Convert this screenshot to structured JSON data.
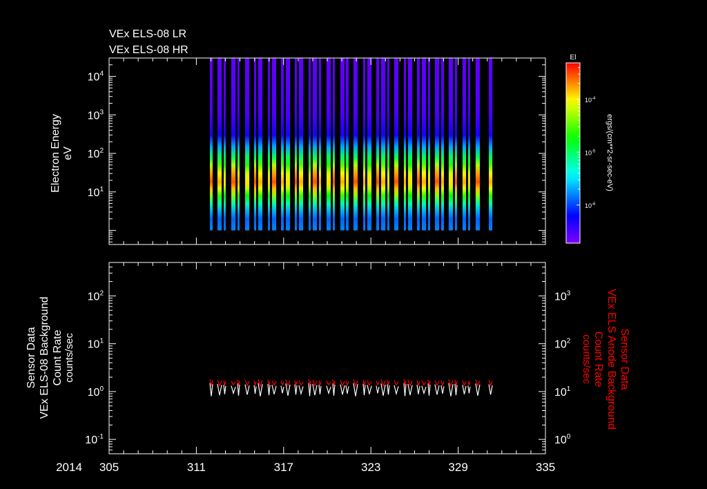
{
  "chart_data": [
    {
      "type": "heatmap",
      "titles": [
        "VEx ELS-08 LR",
        "VEx ELS-08 HR"
      ],
      "ylabel": [
        "Electron Energy",
        "eV"
      ],
      "yscale": "log",
      "ylim": [
        0.43,
        30000
      ],
      "yticks": [
        {
          "base": "10",
          "exp": "1",
          "value": 10
        },
        {
          "base": "10",
          "exp": "2",
          "value": 100
        },
        {
          "base": "10",
          "exp": "3",
          "value": 1000
        },
        {
          "base": "10",
          "exp": "4",
          "value": 10000
        }
      ],
      "energy_range_ev": [
        1,
        30000
      ],
      "colorbar": {
        "label": "El",
        "units": "ergs/(cm**2-sr-sec-eV)",
        "log_range": [
          -6.72,
          -3.31
        ],
        "ticks": [
          {
            "base": "10",
            "exp": "-4",
            "value": -4
          },
          {
            "base": "10",
            "exp": "-5",
            "value": -5
          },
          {
            "base": "10",
            "exp": "-6",
            "value": -6
          }
        ],
        "colors": [
          "#8000ff",
          "#0000ff",
          "#00ffff",
          "#00ff00",
          "#ffff00",
          "#ff0000"
        ]
      },
      "typical_spectrum": {
        "energy_ev": [
          1,
          2,
          3,
          5,
          8,
          12,
          18,
          30,
          50,
          80,
          150,
          300,
          1000,
          30000
        ],
        "log_flux": [
          -5.8,
          -5.9,
          -5.7,
          -5.2,
          -4.6,
          -4.1,
          -3.8,
          -4.0,
          -4.5,
          -5.0,
          -5.7,
          -6.3,
          -6.5,
          -6.6
        ]
      },
      "strips_day": [
        [
          311.93,
          312.12
        ],
        [
          312.45,
          312.74
        ],
        [
          312.88,
          313.02
        ],
        [
          313.4,
          313.69
        ],
        [
          313.83,
          313.97
        ],
        [
          314.35,
          314.64
        ],
        [
          314.97,
          315.11
        ],
        [
          315.25,
          315.54
        ],
        [
          315.92,
          316.06
        ],
        [
          316.2,
          316.49
        ],
        [
          316.82,
          317.01
        ],
        [
          317.15,
          317.44
        ],
        [
          317.77,
          317.91
        ],
        [
          318.05,
          318.34
        ],
        [
          318.72,
          318.86
        ],
        [
          319.0,
          319.29
        ],
        [
          319.43,
          319.57
        ],
        [
          319.95,
          320.24
        ],
        [
          320.38,
          320.52
        ],
        [
          320.9,
          321.19
        ],
        [
          321.28,
          321.47
        ],
        [
          321.8,
          322.09
        ],
        [
          322.47,
          322.61
        ],
        [
          322.75,
          323.04
        ],
        [
          323.37,
          323.56
        ],
        [
          323.7,
          323.99
        ],
        [
          324.13,
          324.27
        ],
        [
          324.6,
          324.89
        ],
        [
          325.27,
          325.41
        ],
        [
          325.55,
          325.84
        ],
        [
          326.17,
          326.36
        ],
        [
          326.5,
          326.79
        ],
        [
          326.93,
          327.07
        ],
        [
          327.4,
          327.69
        ],
        [
          327.83,
          328.02
        ],
        [
          328.35,
          328.64
        ],
        [
          328.78,
          328.92
        ],
        [
          329.3,
          329.54
        ],
        [
          329.68,
          329.82
        ],
        [
          330.2,
          330.49
        ],
        [
          331.11,
          331.35
        ]
      ]
    },
    {
      "type": "line",
      "ylabel_left": [
        "Sensor Data",
        "VEx ELS-08 Background",
        "Count Rate",
        "counts/sec"
      ],
      "ylabel_right": [
        "Sensor Data",
        "VEx ELS Anode Background",
        "Count Rate",
        "counts/sec"
      ],
      "yscale": "log",
      "ylim_left": [
        0.05,
        500
      ],
      "ylim_right": [
        0.5,
        5000
      ],
      "yticks_left": [
        {
          "base": "10",
          "exp": "2",
          "value": 100
        },
        {
          "base": "10",
          "exp": "1",
          "value": 10
        },
        {
          "base": "10",
          "exp": "0",
          "value": 1
        },
        {
          "base": "10",
          "exp": "-1",
          "value": 0.1
        }
      ],
      "yticks_right": [
        {
          "base": "10",
          "exp": "3",
          "value": 1000
        },
        {
          "base": "10",
          "exp": "2",
          "value": 100
        },
        {
          "base": "10",
          "exp": "1",
          "value": 10
        },
        {
          "base": "10",
          "exp": "0",
          "value": 1
        }
      ],
      "series": [
        {
          "name": "VEx ELS-08 Background",
          "axis": "left",
          "color": "#ffffff",
          "min": 0.8,
          "max": 1.5
        },
        {
          "name": "VEx ELS Anode Background",
          "axis": "right",
          "color": "#ff0000",
          "min": 13,
          "max": 18
        }
      ]
    }
  ],
  "xaxis": {
    "year": "2014",
    "range": [
      305,
      335
    ],
    "ticks": [
      "305",
      "311",
      "317",
      "323",
      "329",
      "335"
    ]
  }
}
